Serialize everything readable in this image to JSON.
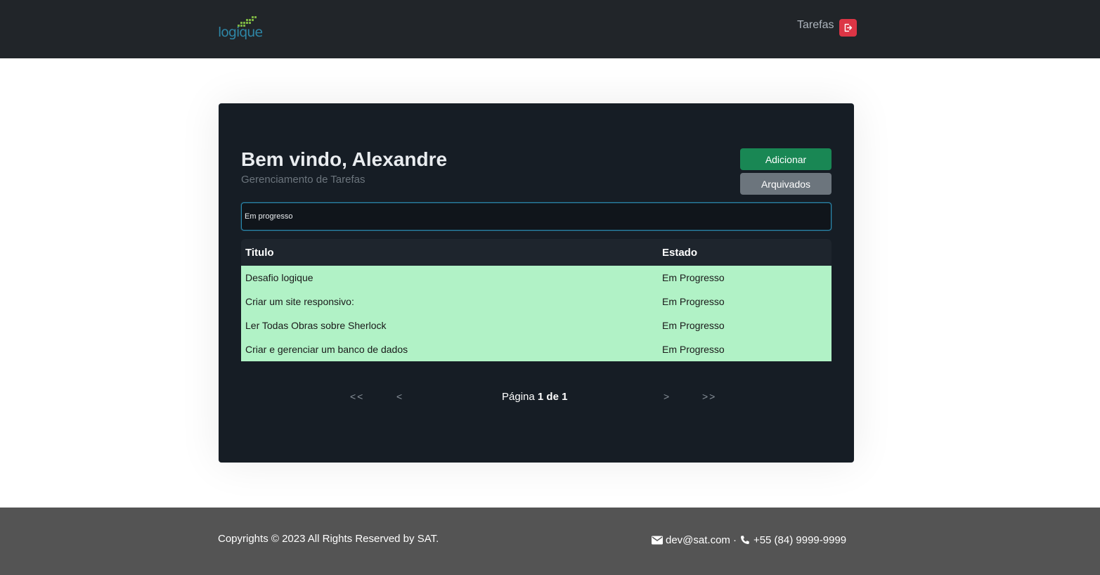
{
  "header": {
    "logo_text": "logique",
    "nav_link": "Tarefas",
    "logout_icon": "logout-icon",
    "logout_color": "#dc3545"
  },
  "card": {
    "welcome": "Bem vindo, Alexandre",
    "subtitle": "Gerenciamento de Tarefas",
    "add_label": "Adicionar",
    "archived_label": "Arquivados",
    "search_value": "Em progresso"
  },
  "table": {
    "headers": {
      "title": "Titulo",
      "state": "Estado"
    },
    "rows": [
      {
        "title": "Desafio logique",
        "state": "Em Progresso"
      },
      {
        "title": "Criar um site responsivo:",
        "state": "Em Progresso"
      },
      {
        "title": "Ler Todas Obras sobre Sherlock",
        "state": "Em Progresso"
      },
      {
        "title": "Criar e gerenciar um banco de dados",
        "state": "Em Progresso"
      }
    ],
    "row_color": "#b1f2c6"
  },
  "pagination": {
    "first": "<<",
    "prev": "<",
    "next": ">",
    "last": ">>",
    "page_word": "Página",
    "current": "1",
    "of_word": "de",
    "total": "1"
  },
  "footer": {
    "copyright": "Copyrights © 2023 All Rights Reserved by SAT.",
    "email": "dev@sat.com",
    "separator": "·",
    "phone": "+55 (84) 9999-9999"
  }
}
